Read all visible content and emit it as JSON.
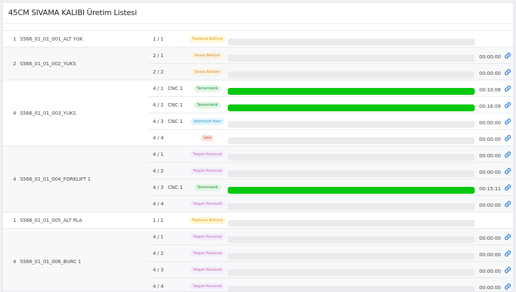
{
  "title": "45CM SIVAMA KALIBI Üretim Listesi",
  "colors": {
    "accent": "#2f7fe0",
    "progress": "#08c80f",
    "track": "#eaebed"
  },
  "groups": [
    {
      "qty": "1",
      "name": "S566_01_01_001_ALT YUK",
      "rows": [
        {
          "sub": "1 / 1",
          "machine": "",
          "status": "Planlama Bekliyor",
          "status_kind": "planlama",
          "progress": 0,
          "time": "",
          "link": false
        }
      ]
    },
    {
      "qty": "2",
      "name": "S566_01_01_002_YUKS",
      "rows": [
        {
          "sub": "2 / 1",
          "machine": "",
          "status": "Dosya Bekliyor",
          "status_kind": "dosya",
          "progress": 0,
          "time": "00:00:00",
          "link": true
        },
        {
          "sub": "2 / 2",
          "machine": "",
          "status": "Dosya Bekliyor",
          "status_kind": "dosya",
          "progress": 0,
          "time": "00:00:00",
          "link": true
        }
      ]
    },
    {
      "qty": "4",
      "name": "S566_01_01_003_YUKS",
      "rows": [
        {
          "sub": "4 / 1",
          "machine": "CNC 1",
          "status": "Tamamlandı",
          "status_kind": "tamam",
          "progress": 100,
          "time": "00:10:08",
          "link": true
        },
        {
          "sub": "4 / 2",
          "machine": "CNC 1",
          "status": "Tamamlandı",
          "status_kind": "tamam",
          "progress": 100,
          "time": "00:16:09",
          "link": true
        },
        {
          "sub": "4 / 3",
          "machine": "CNC 1",
          "status": "İşlenmeye Hazır",
          "status_kind": "islen",
          "progress": 0,
          "time": "00:00:00",
          "link": true
        },
        {
          "sub": "4 / 4",
          "machine": "",
          "status": "İptal",
          "status_kind": "iptal",
          "progress": 0,
          "time": "00:00:00",
          "link": true
        }
      ]
    },
    {
      "qty": "4",
      "name": "S566_01_01_004_FORKLIFT 1",
      "rows": [
        {
          "sub": "4 / 1",
          "machine": "",
          "status": "Tezgah Atanacak",
          "status_kind": "tezgah",
          "progress": 0,
          "time": "00:00:00",
          "link": true
        },
        {
          "sub": "4 / 2",
          "machine": "",
          "status": "Tezgah Atanacak",
          "status_kind": "tezgah",
          "progress": 0,
          "time": "00:00:00",
          "link": true
        },
        {
          "sub": "4 / 3",
          "machine": "CNC 1",
          "status": "Tamamlandı",
          "status_kind": "tamam",
          "progress": 100,
          "time": "00:15:11",
          "link": true
        },
        {
          "sub": "4 / 4",
          "machine": "",
          "status": "Tezgah Atanacak",
          "status_kind": "tezgah",
          "progress": 0,
          "time": "00:00:00",
          "link": true
        }
      ]
    },
    {
      "qty": "1",
      "name": "S566_01_01_005_ALT PLA",
      "rows": [
        {
          "sub": "1 / 1",
          "machine": "",
          "status": "Planlama Bekliyor",
          "status_kind": "planlama",
          "progress": 0,
          "time": "",
          "link": false
        }
      ]
    },
    {
      "qty": "4",
      "name": "S566_01_01_006_BURC 1",
      "rows": [
        {
          "sub": "4 / 1",
          "machine": "",
          "status": "Tezgah Atanacak",
          "status_kind": "tezgah",
          "progress": 0,
          "time": "00:00:00",
          "link": true
        },
        {
          "sub": "4 / 2",
          "machine": "",
          "status": "Tezgah Atanacak",
          "status_kind": "tezgah",
          "progress": 0,
          "time": "00:00:00",
          "link": true
        },
        {
          "sub": "4 / 3",
          "machine": "",
          "status": "Tezgah Atanacak",
          "status_kind": "tezgah",
          "progress": 0,
          "time": "00:00:00",
          "link": true
        },
        {
          "sub": "4 / 4",
          "machine": "",
          "status": "Tezgah Atanacak",
          "status_kind": "tezgah",
          "progress": 0,
          "time": "00:00:00",
          "link": true
        }
      ]
    }
  ]
}
